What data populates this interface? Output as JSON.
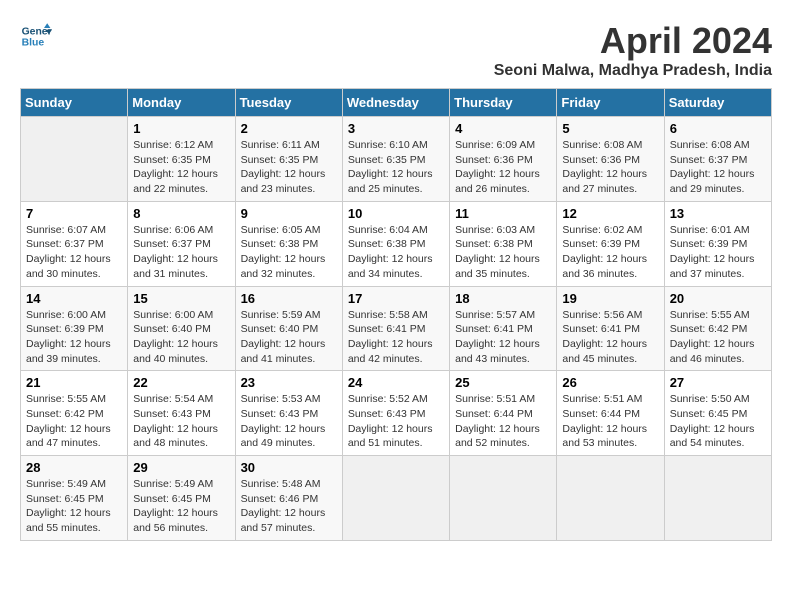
{
  "header": {
    "logo_line1": "General",
    "logo_line2": "Blue",
    "title": "April 2024",
    "subtitle": "Seoni Malwa, Madhya Pradesh, India"
  },
  "columns": [
    "Sunday",
    "Monday",
    "Tuesday",
    "Wednesday",
    "Thursday",
    "Friday",
    "Saturday"
  ],
  "weeks": [
    [
      {
        "day": "",
        "text": ""
      },
      {
        "day": "1",
        "text": "Sunrise: 6:12 AM\nSunset: 6:35 PM\nDaylight: 12 hours\nand 22 minutes."
      },
      {
        "day": "2",
        "text": "Sunrise: 6:11 AM\nSunset: 6:35 PM\nDaylight: 12 hours\nand 23 minutes."
      },
      {
        "day": "3",
        "text": "Sunrise: 6:10 AM\nSunset: 6:35 PM\nDaylight: 12 hours\nand 25 minutes."
      },
      {
        "day": "4",
        "text": "Sunrise: 6:09 AM\nSunset: 6:36 PM\nDaylight: 12 hours\nand 26 minutes."
      },
      {
        "day": "5",
        "text": "Sunrise: 6:08 AM\nSunset: 6:36 PM\nDaylight: 12 hours\nand 27 minutes."
      },
      {
        "day": "6",
        "text": "Sunrise: 6:08 AM\nSunset: 6:37 PM\nDaylight: 12 hours\nand 29 minutes."
      }
    ],
    [
      {
        "day": "7",
        "text": "Sunrise: 6:07 AM\nSunset: 6:37 PM\nDaylight: 12 hours\nand 30 minutes."
      },
      {
        "day": "8",
        "text": "Sunrise: 6:06 AM\nSunset: 6:37 PM\nDaylight: 12 hours\nand 31 minutes."
      },
      {
        "day": "9",
        "text": "Sunrise: 6:05 AM\nSunset: 6:38 PM\nDaylight: 12 hours\nand 32 minutes."
      },
      {
        "day": "10",
        "text": "Sunrise: 6:04 AM\nSunset: 6:38 PM\nDaylight: 12 hours\nand 34 minutes."
      },
      {
        "day": "11",
        "text": "Sunrise: 6:03 AM\nSunset: 6:38 PM\nDaylight: 12 hours\nand 35 minutes."
      },
      {
        "day": "12",
        "text": "Sunrise: 6:02 AM\nSunset: 6:39 PM\nDaylight: 12 hours\nand 36 minutes."
      },
      {
        "day": "13",
        "text": "Sunrise: 6:01 AM\nSunset: 6:39 PM\nDaylight: 12 hours\nand 37 minutes."
      }
    ],
    [
      {
        "day": "14",
        "text": "Sunrise: 6:00 AM\nSunset: 6:39 PM\nDaylight: 12 hours\nand 39 minutes."
      },
      {
        "day": "15",
        "text": "Sunrise: 6:00 AM\nSunset: 6:40 PM\nDaylight: 12 hours\nand 40 minutes."
      },
      {
        "day": "16",
        "text": "Sunrise: 5:59 AM\nSunset: 6:40 PM\nDaylight: 12 hours\nand 41 minutes."
      },
      {
        "day": "17",
        "text": "Sunrise: 5:58 AM\nSunset: 6:41 PM\nDaylight: 12 hours\nand 42 minutes."
      },
      {
        "day": "18",
        "text": "Sunrise: 5:57 AM\nSunset: 6:41 PM\nDaylight: 12 hours\nand 43 minutes."
      },
      {
        "day": "19",
        "text": "Sunrise: 5:56 AM\nSunset: 6:41 PM\nDaylight: 12 hours\nand 45 minutes."
      },
      {
        "day": "20",
        "text": "Sunrise: 5:55 AM\nSunset: 6:42 PM\nDaylight: 12 hours\nand 46 minutes."
      }
    ],
    [
      {
        "day": "21",
        "text": "Sunrise: 5:55 AM\nSunset: 6:42 PM\nDaylight: 12 hours\nand 47 minutes."
      },
      {
        "day": "22",
        "text": "Sunrise: 5:54 AM\nSunset: 6:43 PM\nDaylight: 12 hours\nand 48 minutes."
      },
      {
        "day": "23",
        "text": "Sunrise: 5:53 AM\nSunset: 6:43 PM\nDaylight: 12 hours\nand 49 minutes."
      },
      {
        "day": "24",
        "text": "Sunrise: 5:52 AM\nSunset: 6:43 PM\nDaylight: 12 hours\nand 51 minutes."
      },
      {
        "day": "25",
        "text": "Sunrise: 5:51 AM\nSunset: 6:44 PM\nDaylight: 12 hours\nand 52 minutes."
      },
      {
        "day": "26",
        "text": "Sunrise: 5:51 AM\nSunset: 6:44 PM\nDaylight: 12 hours\nand 53 minutes."
      },
      {
        "day": "27",
        "text": "Sunrise: 5:50 AM\nSunset: 6:45 PM\nDaylight: 12 hours\nand 54 minutes."
      }
    ],
    [
      {
        "day": "28",
        "text": "Sunrise: 5:49 AM\nSunset: 6:45 PM\nDaylight: 12 hours\nand 55 minutes."
      },
      {
        "day": "29",
        "text": "Sunrise: 5:49 AM\nSunset: 6:45 PM\nDaylight: 12 hours\nand 56 minutes."
      },
      {
        "day": "30",
        "text": "Sunrise: 5:48 AM\nSunset: 6:46 PM\nDaylight: 12 hours\nand 57 minutes."
      },
      {
        "day": "",
        "text": ""
      },
      {
        "day": "",
        "text": ""
      },
      {
        "day": "",
        "text": ""
      },
      {
        "day": "",
        "text": ""
      }
    ]
  ]
}
